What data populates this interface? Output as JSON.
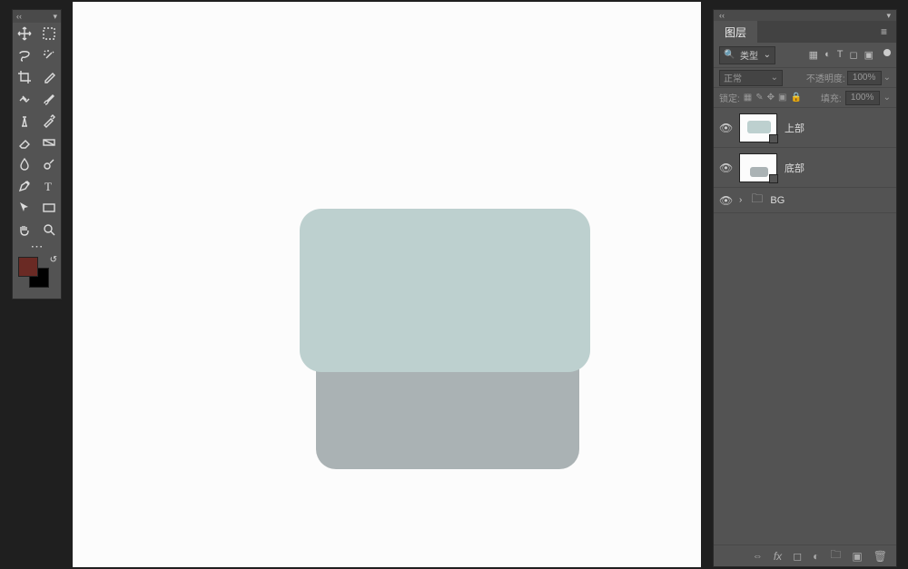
{
  "tools": {
    "items": [
      "move",
      "marquee",
      "lasso",
      "magic-wand",
      "crop",
      "eyedropper",
      "spot-heal",
      "brush",
      "clone",
      "history-brush",
      "eraser",
      "gradient",
      "blur",
      "dodge",
      "pen",
      "type",
      "path-select",
      "rectangle",
      "hand",
      "zoom"
    ],
    "fg_color": "#6a2a24",
    "bg_color": "#000000"
  },
  "canvas": {
    "bg": "#fcfcfc",
    "top_shape_color": "#bdd0cf",
    "bottom_shape_color": "#aab2b4"
  },
  "layers_panel": {
    "tab_label": "图层",
    "filter_label": "类型",
    "blend_mode": "正常",
    "opacity_label": "不透明度:",
    "opacity_value": "100%",
    "lock_label": "锁定:",
    "fill_label": "填充:",
    "fill_value": "100%",
    "layers": [
      {
        "name": "上部",
        "kind": "shape",
        "thumb": "top"
      },
      {
        "name": "底部",
        "kind": "shape",
        "thumb": "bottom"
      },
      {
        "name": "BG",
        "kind": "group"
      }
    ],
    "bottom_icons": [
      "link",
      "fx",
      "mask",
      "adjust",
      "group",
      "new",
      "trash"
    ]
  }
}
